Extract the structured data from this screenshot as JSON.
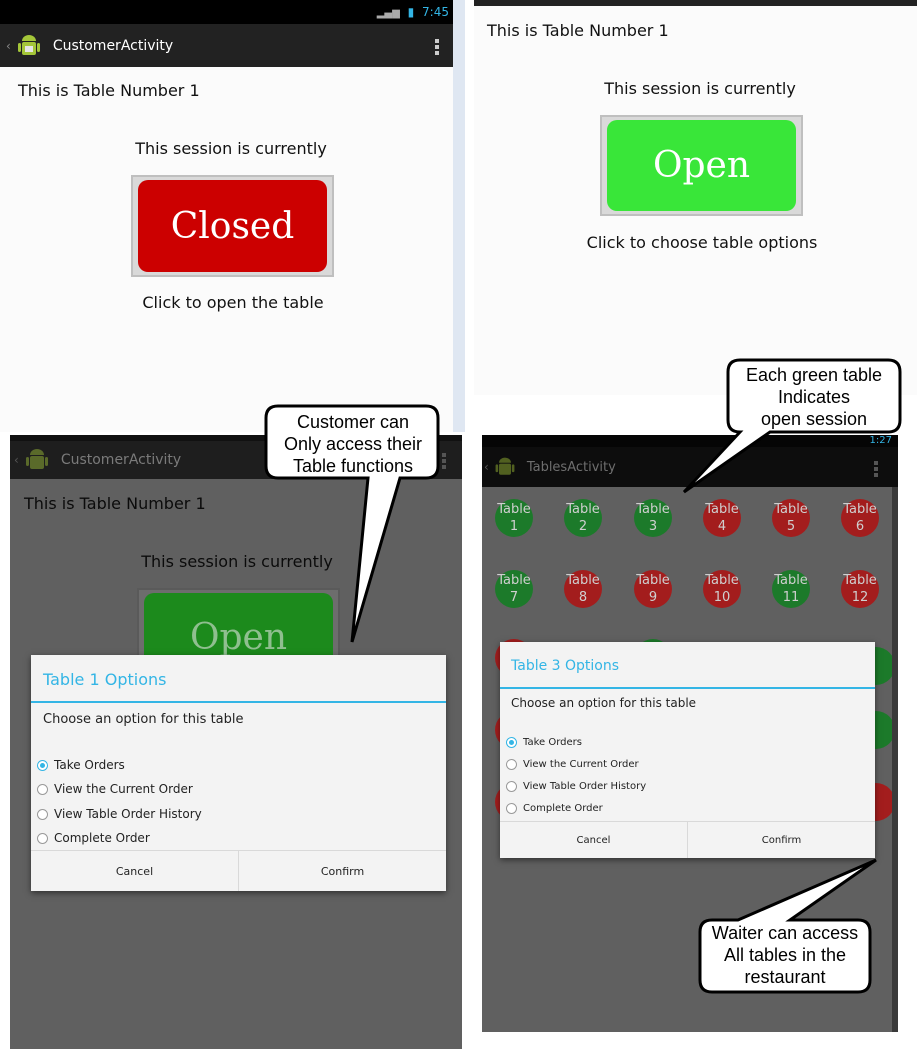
{
  "colors": {
    "accent": "#33b5e5",
    "closed": "#cc0000",
    "open": "#39e639",
    "open_dim": "#1c7a1c",
    "green_table": "#1c7a2a",
    "red_table": "#a31d1d"
  },
  "panel_a": {
    "status_time": "7:45",
    "app_title": "CustomerActivity",
    "table_label": "This is Table Number 1",
    "session_label": "This session is currently",
    "status_button": "Closed",
    "hint": "Click to open the table"
  },
  "panel_b": {
    "table_label": "This is Table Number 1",
    "session_label": "This session is currently",
    "status_button": "Open",
    "hint": "Click to choose table options"
  },
  "panel_c": {
    "app_title": "CustomerActivity",
    "table_label": "This is Table Number 1",
    "session_label": "This session is currently",
    "status_button": "Open",
    "dialog": {
      "title": "Table 1 Options",
      "message": "Choose an option for this table",
      "options": [
        "Take Orders",
        "View the Current Order",
        "View Table Order History",
        "Complete Order"
      ],
      "selected_index": 0,
      "cancel": "Cancel",
      "confirm": "Confirm"
    }
  },
  "panel_d": {
    "status_time": "1:27",
    "app_title": "TablesActivity",
    "table_word": "Table",
    "tables_row1": [
      {
        "number": "1",
        "status": "green"
      },
      {
        "number": "2",
        "status": "green"
      },
      {
        "number": "3",
        "status": "green"
      },
      {
        "number": "4",
        "status": "red"
      },
      {
        "number": "5",
        "status": "red"
      },
      {
        "number": "6",
        "status": "red"
      }
    ],
    "tables_row2": [
      {
        "number": "7",
        "status": "green"
      },
      {
        "number": "8",
        "status": "red"
      },
      {
        "number": "9",
        "status": "red"
      },
      {
        "number": "10",
        "status": "red"
      },
      {
        "number": "11",
        "status": "green"
      },
      {
        "number": "12",
        "status": "red"
      }
    ],
    "dialog": {
      "title": "Table 3 Options",
      "message": "Choose an option for this table",
      "options": [
        "Take Orders",
        "View the Current Order",
        "View Table Order History",
        "Complete Order"
      ],
      "selected_index": 0,
      "cancel": "Cancel",
      "confirm": "Confirm"
    }
  },
  "callouts": {
    "customer": [
      "Customer can",
      "Only access their",
      "Table functions"
    ],
    "green_table": [
      "Each green table",
      "Indicates",
      "open session"
    ],
    "waiter": [
      "Waiter can access",
      "All tables in the",
      "restaurant"
    ]
  }
}
